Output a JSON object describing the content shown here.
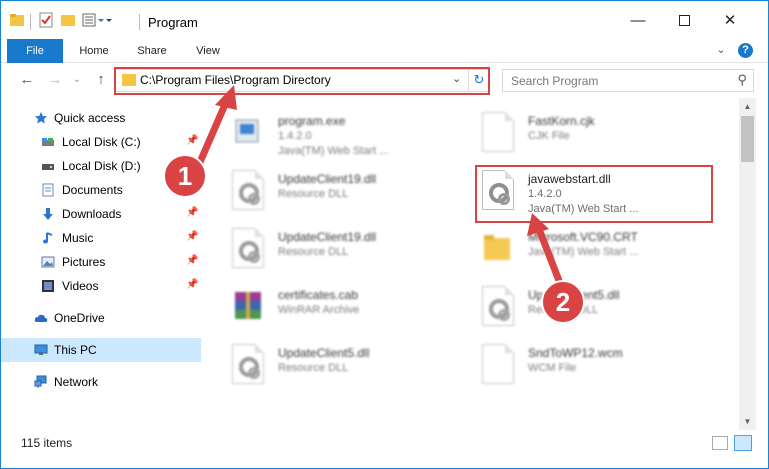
{
  "window": {
    "title": "Program",
    "minimize_icon": "minimize-icon",
    "maximize_icon": "maximize-icon",
    "close_icon": "close-icon"
  },
  "ribbon": {
    "tabs": [
      "File",
      "Home",
      "Share",
      "View"
    ],
    "accent": "#1979ca"
  },
  "address": {
    "path": "C:\\Program Files\\Program Directory"
  },
  "search": {
    "placeholder": "Search Program"
  },
  "sidebar": {
    "items": [
      {
        "label": "Quick access",
        "icon": "star-icon",
        "pinned": false
      },
      {
        "label": "Local Disk (C:)",
        "icon": "drive-icon",
        "pinned": true
      },
      {
        "label": "Local Disk (D:)",
        "icon": "drive-icon",
        "pinned": true
      },
      {
        "label": "Documents",
        "icon": "documents-icon",
        "pinned": true
      },
      {
        "label": "Downloads",
        "icon": "download-icon",
        "pinned": true
      },
      {
        "label": "Music",
        "icon": "music-icon",
        "pinned": true
      },
      {
        "label": "Pictures",
        "icon": "pictures-icon",
        "pinned": true
      },
      {
        "label": "Videos",
        "icon": "video-icon",
        "pinned": true
      },
      {
        "label": "OneDrive",
        "icon": "cloud-icon",
        "pinned": false
      },
      {
        "label": "This PC",
        "icon": "computer-icon",
        "pinned": false
      },
      {
        "label": "Network",
        "icon": "network-icon",
        "pinned": false
      }
    ]
  },
  "files": [
    {
      "name": "program.exe",
      "line1": "1.4.2.0",
      "line2": "Java(TM) Web Start ..."
    },
    {
      "name": "FastKorn.cjk",
      "line1": "CJK File",
      "line2": ""
    },
    {
      "name": "UpdateClient19.dll",
      "line1": "Resource DLL",
      "line2": ""
    },
    {
      "name": "javawebstart.dll",
      "line1": "1.4.2.0",
      "line2": "Java(TM) Web Start ..."
    },
    {
      "name": "UpdateClient19.dll",
      "line1": "Resource DLL",
      "line2": ""
    },
    {
      "name": "Microsoft.VC90.CRT",
      "line1": "Java(TM) Web Start ...",
      "line2": ""
    },
    {
      "name": "certificates.cab",
      "line1": "WinRAR Archive",
      "line2": ""
    },
    {
      "name": "UpdateClient5.dll",
      "line1": "Resource DLL",
      "line2": ""
    },
    {
      "name": "UpdateClient5.dll",
      "line1": "Resource DLL",
      "line2": ""
    },
    {
      "name": "SndToWP12.wcm",
      "line1": "WCM File",
      "line2": ""
    }
  ],
  "status": {
    "count": "115 items"
  },
  "callouts": [
    "1",
    "2"
  ],
  "highlight_color": "#d94343"
}
